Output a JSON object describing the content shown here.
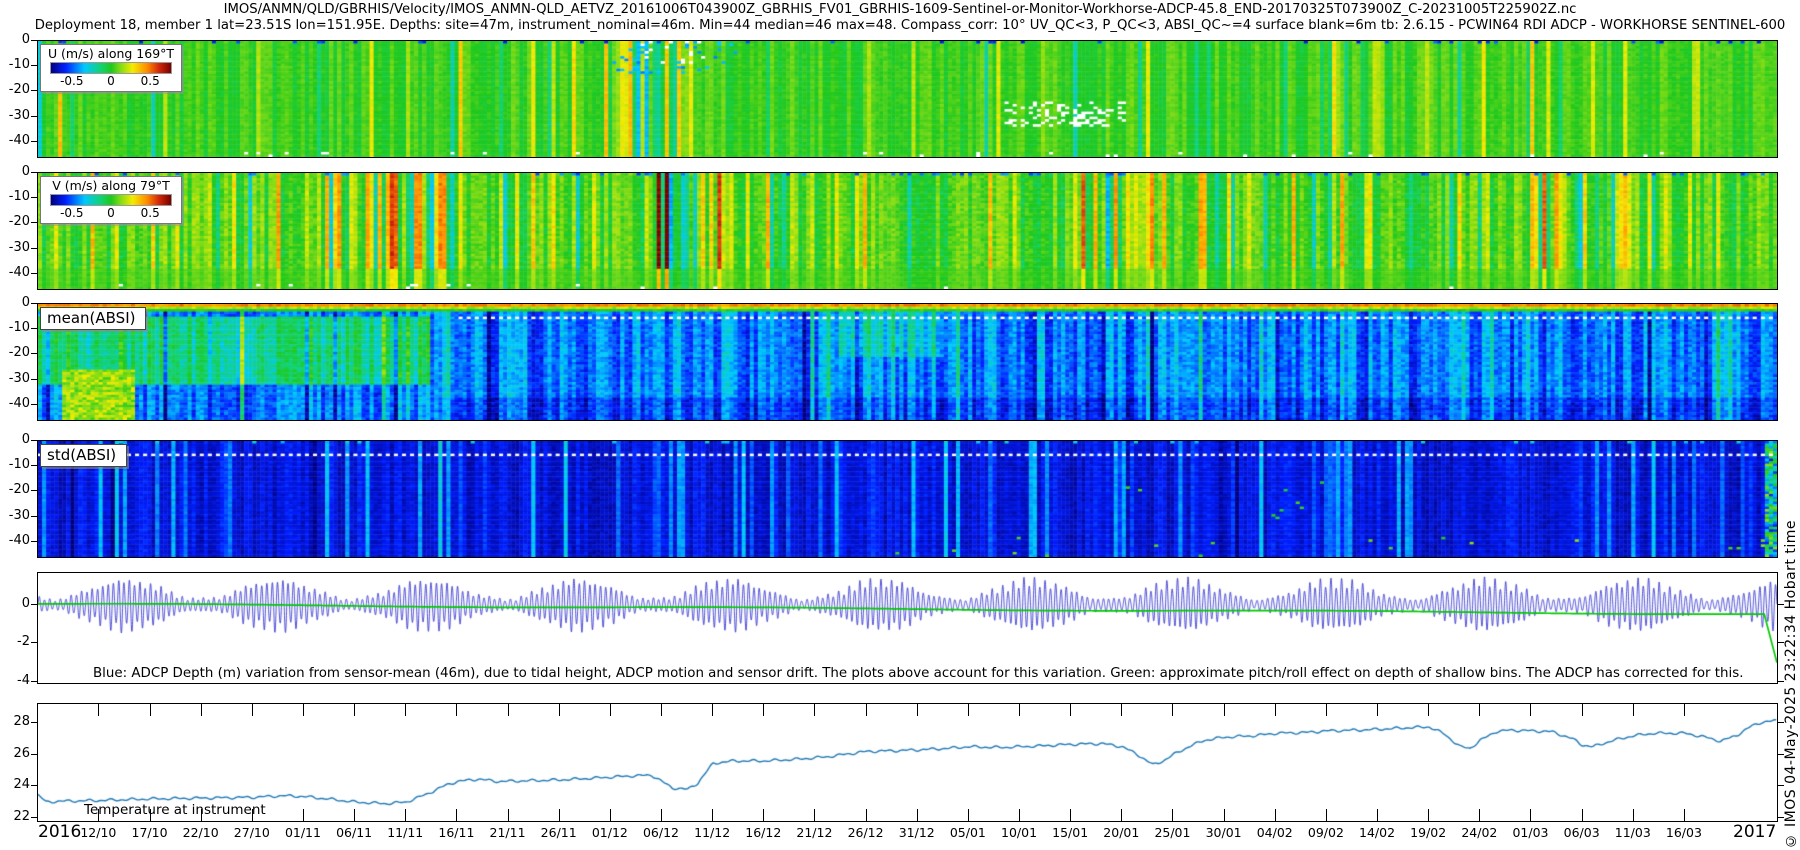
{
  "header": {
    "title": "IMOS/ANMN/QLD/GBRHIS/Velocity/IMOS_ANMN-QLD_AETVZ_20161006T043900Z_GBRHIS_FV01_GBRHIS-1609-Sentinel-or-Monitor-Workhorse-ADCP-45.8_END-20170325T073900Z_C-20231005T225902Z.nc",
    "subtitle": "Deployment 18, member 1 lat=23.51S lon=151.95E. Depths: site=47m, instrument_nominal=46m. Min=44 median=46 max=48. Compass_corr: 10° UV_QC<3, P_QC<3, ABSI_QC~=4 surface blank=6m tb: 2.6.15 - PCWIN64 RDI ADCP - WORKHORSE SENTINEL-600"
  },
  "note": "Blue: ADCP Depth (m) variation from sensor-mean (46m), due to tidal height, ADCP motion and sensor drift. The plots above account for this variation. Green: approximate pitch/roll effect on depth of shallow bins. The ADCP has corrected for this.",
  "watermark": "© IMOS 04-May-2025 23:22:34 Hobart time",
  "x_axis": {
    "start_year_label": "2016",
    "end_year_label": "2017",
    "first_tick_day": 6,
    "tick_interval_days": 5,
    "total_days": 170,
    "tick_labels": [
      "12/10",
      "17/10",
      "22/10",
      "27/10",
      "01/11",
      "06/11",
      "11/11",
      "16/11",
      "21/11",
      "26/11",
      "01/12",
      "06/12",
      "11/12",
      "16/12",
      "21/12",
      "26/12",
      "31/12",
      "05/01",
      "10/01",
      "15/01",
      "20/01",
      "25/01",
      "30/01",
      "04/02",
      "09/02",
      "14/02",
      "19/02",
      "24/02",
      "01/03",
      "06/03",
      "11/03",
      "16/03"
    ]
  },
  "chart_data": [
    {
      "id": "u_velocity",
      "type": "heatmap",
      "legend": {
        "title": "U (m/s) along 169°T",
        "ticks": [
          "-0.5",
          "0",
          "0.5"
        ],
        "colormap": "jet",
        "clim": [
          -0.9,
          0.9
        ]
      },
      "y_ticks": [
        0,
        -10,
        -20,
        -30,
        -40
      ],
      "ylim": [
        0,
        -46
      ],
      "xlim_days": [
        0,
        170
      ],
      "summary": "Cross-shore velocity vs depth/time; mostly near 0 (green) with short vertical bursts to ±0.4 m/s and scattered data gaps",
      "render": {
        "seed": 7,
        "ncols": 430,
        "nrows": 46,
        "base": 0.52,
        "col_noise": 0.045,
        "cell_noise": 0.02,
        "event_prob": 0.12,
        "event_min": 0.05,
        "event_max": 0.2,
        "event_pos_bias": 0.55,
        "busy": [
          {
            "x0": 0.325,
            "x1": 0.375,
            "amp": 0.22,
            "shift": 0
          },
          {
            "x0": 0.74,
            "x1": 0.78,
            "amp": 0.12,
            "shift": 0
          }
        ],
        "speckles": [
          {
            "x0": 0,
            "x1": 1,
            "r0": 0,
            "r1": 0,
            "prob": 0.1,
            "t": 0.15
          },
          {
            "x0": 0.33,
            "x1": 0.4,
            "r0": 0,
            "r1": 12,
            "prob": 0.07,
            "t": 0.25
          }
        ],
        "gap_clusters": [
          {
            "x0": 0.555,
            "x1": 0.625,
            "r0": 24,
            "r1": 33,
            "prob": 0.3
          },
          {
            "x0": 0.345,
            "x1": 0.385,
            "r0": 0,
            "r1": 8,
            "prob": 0.1
          },
          {
            "x0": 0.05,
            "x1": 0.95,
            "r0": 44,
            "r1": 45,
            "prob": 0.012
          }
        ],
        "bottom_gap_prob": 0.012
      }
    },
    {
      "id": "v_velocity",
      "type": "heatmap",
      "legend": {
        "title": "V (m/s) along 79°T",
        "ticks": [
          "-0.5",
          "0",
          "0.5"
        ],
        "colormap": "jet",
        "clim": [
          -0.9,
          0.9
        ]
      },
      "y_ticks": [
        0,
        -10,
        -20,
        -30,
        -40
      ],
      "ylim": [
        0,
        -46
      ],
      "xlim_days": [
        0,
        170
      ],
      "summary": "Along-shore velocity vs depth/time; green background with frequent yellow/orange bursts and dark-red clusters (late Oct, late Nov); bottom bins more uniform",
      "render": {
        "seed": 23,
        "ncols": 430,
        "nrows": 46,
        "base": 0.53,
        "col_noise": 0.07,
        "cell_noise": 0.035,
        "event_prob": 0.25,
        "event_min": 0.06,
        "event_max": 0.22,
        "event_pos_bias": 0.75,
        "busy": [
          {
            "x0": 0.165,
            "x1": 0.245,
            "amp": 0.26,
            "shift": 0.06
          },
          {
            "x0": 0.345,
            "x1": 0.395,
            "amp": 0.3,
            "shift": 0.08
          },
          {
            "x0": 0.6,
            "x1": 0.64,
            "amp": 0.18,
            "shift": 0.04
          },
          {
            "x0": 0.86,
            "x1": 0.93,
            "amp": 0.18,
            "shift": 0
          }
        ],
        "speckles": [
          {
            "x0": 0,
            "x1": 1,
            "r0": 0,
            "r1": 0,
            "prob": 0.12,
            "t": 0.2
          }
        ],
        "bottom_damp": {
          "row": 37,
          "k": 0.45
        },
        "gap_clusters": [
          {
            "x0": 0.1,
            "x1": 0.95,
            "r0": 44,
            "r1": 45,
            "prob": 0.012
          }
        ],
        "bottom_gap_prob": 0.01
      }
    },
    {
      "id": "mean_absi",
      "type": "heatmap",
      "label": "mean(ABSI)",
      "y_ticks": [
        0,
        -10,
        -20,
        -30,
        -40
      ],
      "ylim": [
        0,
        -46
      ],
      "xlim_days": [
        0,
        170
      ],
      "summary": "Mean acoustic backscatter: orange/yellow surface band, green-yellow patch in first quarter of record, blue/cyan vertical streaks elsewhere, dotted white line near 5 m",
      "render": {
        "seed": 41,
        "ncols": 430,
        "nrows": 46,
        "base": 0.21,
        "col_noise": 0.09,
        "cell_noise": 0.05,
        "event_prob": 0.18,
        "event_min": 0.05,
        "event_max": 0.17,
        "event_pos_bias": 0.5,
        "surface": [
          0.8,
          0.62,
          0.5
        ],
        "patches": [
          {
            "x0": 0,
            "x1": 0.225,
            "r0": 5,
            "r1": 31,
            "dt": 0.2
          },
          {
            "x0": 0.012,
            "x1": 0.055,
            "r0": 26,
            "r1": 45,
            "t": 0.6,
            "jitter": 0.08
          },
          {
            "x0": 0.46,
            "x1": 0.52,
            "r0": 3,
            "r1": 20,
            "dt": 0.1
          },
          {
            "x0": 0.23,
            "x1": 1,
            "r0": 37,
            "r1": 45,
            "dt": -0.06
          }
        ],
        "dotted_row": 5,
        "dotted_from": 0.24
      }
    },
    {
      "id": "std_absi",
      "type": "heatmap",
      "label": "std(ABSI)",
      "y_ticks": [
        0,
        -10,
        -20,
        -30,
        -40
      ],
      "ylim": [
        0,
        -46
      ],
      "xlim_days": [
        0,
        170
      ],
      "summary": "Std of backscatter: dark navy field with lighter-blue vertical streaks, dotted white line near 5 m, sparse bright specks near the bottom in the second half",
      "render": {
        "seed": 59,
        "ncols": 430,
        "nrows": 46,
        "base": 0.085,
        "col_noise": 0.04,
        "cell_noise": 0.025,
        "event_prob": 0.2,
        "event_min": 0.04,
        "event_max": 0.2,
        "event_pos_bias": 0.95,
        "dotted_row": 5,
        "dotted_from": 0,
        "speckles": [
          {
            "x0": 0.45,
            "x1": 1,
            "r0": 38,
            "r1": 45,
            "prob": 0.012,
            "t": 0.55
          },
          {
            "x0": 0.55,
            "x1": 0.75,
            "r0": 10,
            "r1": 30,
            "prob": 0.004,
            "t": 0.5
          },
          {
            "x0": 0,
            "x1": 1,
            "r0": 0,
            "r1": 0,
            "prob": 0.05,
            "t": 0.3
          }
        ],
        "patches": [
          {
            "x0": 0.993,
            "x1": 1,
            "r0": 0,
            "r1": 45,
            "t": 0.35,
            "jitter": 0.25
          }
        ]
      }
    },
    {
      "id": "depth_variation",
      "type": "line",
      "y_ticks": [
        0,
        -2,
        -4
      ],
      "ylim": [
        1.65,
        -4.05
      ],
      "xlim_days": [
        0,
        170
      ],
      "series": [
        {
          "name": "adcp_depth_variation_m",
          "color": "#2323cc",
          "tidal": {
            "semidiurnal_period_days": 0.5175,
            "diurnal_period_days": 1.0027,
            "spring_neap_period_days": 14.77,
            "amp_min": 0.27,
            "amp_max": 1.17
          }
        },
        {
          "name": "pitch_roll_effect_m",
          "color": "#00c800",
          "start_value": 0.05,
          "end_value": -0.48,
          "final_plunge_value": -3.0
        }
      ]
    },
    {
      "id": "temperature",
      "type": "line",
      "label": "Temperature at instrument",
      "y_ticks": [
        28,
        26,
        24,
        22
      ],
      "ylim": [
        29.2,
        21.8
      ],
      "xlim_days": [
        0,
        170
      ],
      "color": "#1f77b4",
      "control_points": [
        [
          0,
          23.45
        ],
        [
          0.8,
          23.0
        ],
        [
          2,
          23.05
        ],
        [
          6,
          23.1
        ],
        [
          11,
          23.2
        ],
        [
          16,
          23.25
        ],
        [
          21,
          23.3
        ],
        [
          24,
          23.4
        ],
        [
          26,
          23.35
        ],
        [
          29,
          23.15
        ],
        [
          31,
          23.0
        ],
        [
          34,
          22.9
        ],
        [
          36,
          23.0
        ],
        [
          38,
          23.5
        ],
        [
          40,
          24.1
        ],
        [
          41,
          24.3
        ],
        [
          43,
          24.45
        ],
        [
          45,
          24.3
        ],
        [
          48,
          24.35
        ],
        [
          51,
          24.4
        ],
        [
          54,
          24.5
        ],
        [
          58,
          24.65
        ],
        [
          60,
          24.7
        ],
        [
          61,
          24.3
        ],
        [
          62,
          23.9
        ],
        [
          63.5,
          23.8
        ],
        [
          64.5,
          24.2
        ],
        [
          66,
          25.45
        ],
        [
          68,
          25.6
        ],
        [
          71,
          25.6
        ],
        [
          74,
          25.7
        ],
        [
          77,
          25.85
        ],
        [
          81,
          26.2
        ],
        [
          84,
          26.25
        ],
        [
          86,
          26.3
        ],
        [
          89,
          26.4
        ],
        [
          91,
          26.5
        ],
        [
          94,
          26.45
        ],
        [
          98,
          26.55
        ],
        [
          101,
          26.65
        ],
        [
          104,
          26.7
        ],
        [
          106,
          26.5
        ],
        [
          107.5,
          26.0
        ],
        [
          109,
          25.35
        ],
        [
          110,
          25.6
        ],
        [
          111,
          26.0
        ],
        [
          112.5,
          26.5
        ],
        [
          114,
          26.9
        ],
        [
          116,
          27.1
        ],
        [
          119,
          27.2
        ],
        [
          121,
          27.35
        ],
        [
          124,
          27.4
        ],
        [
          126,
          27.5
        ],
        [
          129,
          27.55
        ],
        [
          131,
          27.6
        ],
        [
          134,
          27.7
        ],
        [
          136,
          27.75
        ],
        [
          137.5,
          27.3
        ],
        [
          139,
          26.5
        ],
        [
          140,
          26.4
        ],
        [
          141,
          26.9
        ],
        [
          142.5,
          27.45
        ],
        [
          144,
          27.55
        ],
        [
          146,
          27.5
        ],
        [
          148,
          27.45
        ],
        [
          150,
          27.0
        ],
        [
          151,
          26.6
        ],
        [
          152,
          26.5
        ],
        [
          154,
          26.9
        ],
        [
          156,
          27.2
        ],
        [
          158,
          27.35
        ],
        [
          161,
          27.35
        ],
        [
          163,
          27.1
        ],
        [
          164.5,
          26.85
        ],
        [
          166,
          27.2
        ],
        [
          167.5,
          27.8
        ],
        [
          168.5,
          28.05
        ],
        [
          170,
          28.15
        ]
      ]
    }
  ]
}
